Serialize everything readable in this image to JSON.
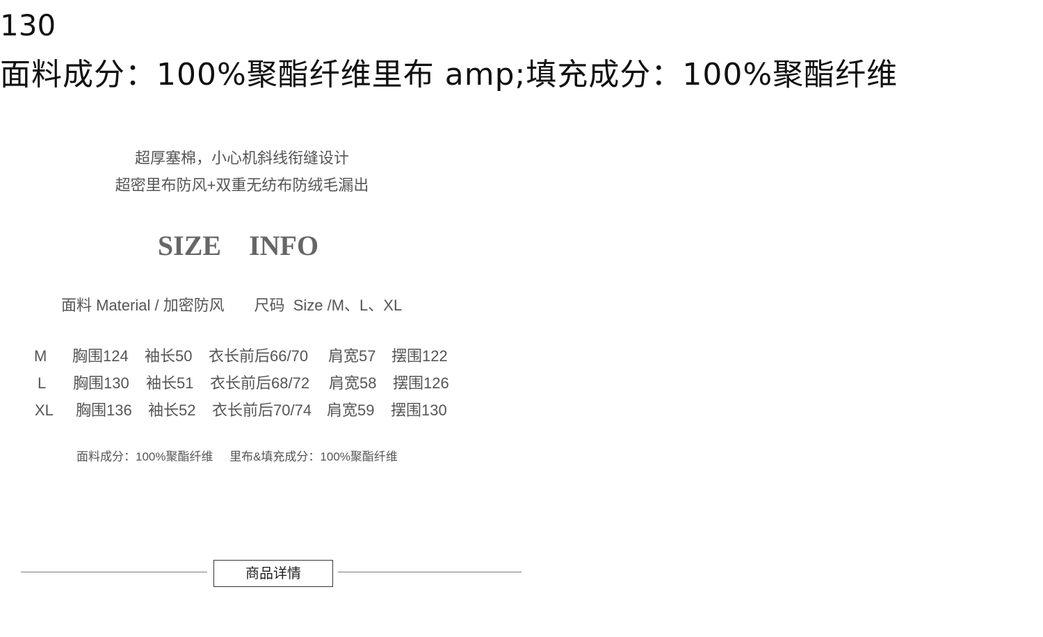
{
  "header": {
    "number": "130",
    "material_line": "面料成分：100%聚酯纤维里布 amp;填充成分：100%聚酯纤维"
  },
  "features": [
    "超厚塞棉，小心机斜线衔缝设计",
    "超密里布防风+双重无纺布防绒毛漏出"
  ],
  "size_info": {
    "title": "SIZE    INFO",
    "spec_line": "面料 Material / 加密防风       尺码  Size /M、L、XL",
    "rows": [
      {
        "size": "M",
        "chest": "胸围124",
        "sleeve": "袖长50",
        "length": "衣长前后66/70",
        "shoulder": "肩宽57",
        "hem": "摆围122"
      },
      {
        "size": "L",
        "chest": "胸围130",
        "sleeve": "袖长51",
        "length": "衣长前后68/72",
        "shoulder": "肩宽58",
        "hem": "摆围126"
      },
      {
        "size": "XL",
        "chest": "胸围136",
        "sleeve": "袖长52",
        "length": "衣长前后70/74",
        "shoulder": "肩宽59",
        "hem": "摆围130"
      }
    ],
    "composition": "面料成分：100%聚酯纤维     里布&填充成分：100%聚酯纤维"
  },
  "footer": {
    "details_tab": "商品详情"
  }
}
